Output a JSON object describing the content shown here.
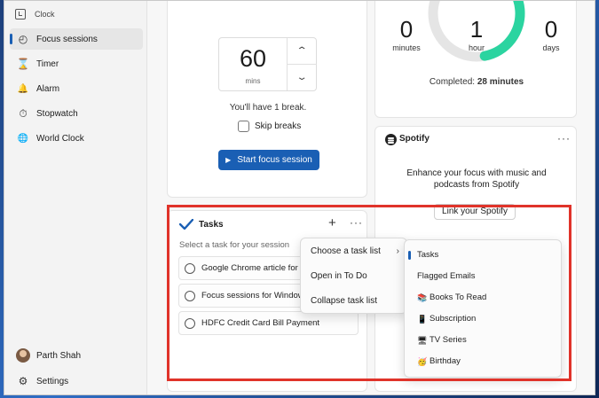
{
  "window": {
    "title": "Clock",
    "minimize": "—",
    "maximize": "☐",
    "close": "✕"
  },
  "sidebar": {
    "items": [
      {
        "label": "Focus sessions",
        "icon": "focus-icon",
        "glyph": "◴",
        "active": true
      },
      {
        "label": "Timer",
        "icon": "hourglass-icon",
        "glyph": "⌛"
      },
      {
        "label": "Alarm",
        "icon": "bell-icon",
        "glyph": "🔔"
      },
      {
        "label": "Stopwatch",
        "icon": "stopwatch-icon",
        "glyph": "⏱"
      },
      {
        "label": "World Clock",
        "icon": "globe-icon",
        "glyph": "🌐"
      }
    ],
    "user": {
      "name": "Parth Shah"
    },
    "settings": {
      "label": "Settings",
      "glyph": "⚙"
    }
  },
  "timer": {
    "value": "60",
    "unit": "mins",
    "up": "⌃",
    "down": "⌄",
    "break_text": "You'll have 1 break.",
    "skip_label": "Skip breaks",
    "start_label": "Start focus session",
    "play_glyph": "▶"
  },
  "progress": {
    "yesterday_value": "0",
    "yesterday_unit": "minutes",
    "goal_value": "1",
    "goal_unit": "hour",
    "streak_value": "0",
    "streak_unit": "days",
    "completed_label": "Completed:",
    "completed_value": "28 minutes",
    "completion_fraction": 0.47,
    "accent": "#2bd4a0"
  },
  "spotify": {
    "name": "Spotify",
    "more": "···",
    "description": "Enhance your focus with music and podcasts from Spotify",
    "link_label": "Link your Spotify"
  },
  "tasks": {
    "title": "Tasks",
    "add": "+",
    "more": "···",
    "hint": "Select a task for your session",
    "items": [
      {
        "text": "Google Chrome article for T"
      },
      {
        "text": "Focus sessions for Window"
      },
      {
        "text": "HDFC Credit Card Bill Payment"
      }
    ]
  },
  "context_menu": {
    "items": [
      {
        "label": "Choose a task list",
        "arrow": "›"
      },
      {
        "label": "Open in To Do"
      },
      {
        "label": "Collapse task list"
      }
    ]
  },
  "task_lists": {
    "items": [
      {
        "label": "Tasks",
        "active": true,
        "emoji": ""
      },
      {
        "label": "Flagged Emails",
        "emoji": ""
      },
      {
        "label": "Books To Read",
        "emoji": "📚"
      },
      {
        "label": "Subscription",
        "emoji": "📱"
      },
      {
        "label": "TV Series",
        "emoji": "🖥"
      },
      {
        "label": "Birthday",
        "emoji": "🥳"
      }
    ]
  },
  "colors": {
    "accent": "#1a5fb4",
    "highlight": "#e0332a",
    "ring_track": "#e5e5e5"
  }
}
